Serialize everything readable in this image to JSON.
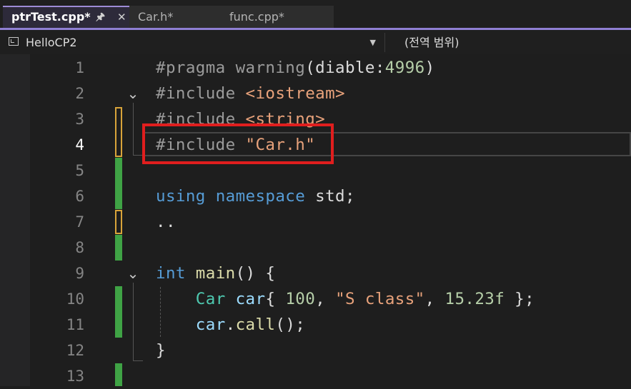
{
  "tabs": [
    {
      "label": "ptrTest.cpp*",
      "active": true,
      "pin_icon": "pin-icon",
      "close_icon": "close-icon"
    },
    {
      "label": "Car.h*",
      "active": false
    },
    {
      "label": "func.cpp*",
      "active": false
    }
  ],
  "navbar": {
    "project": "HelloCP2",
    "scope": "(전역 범위)"
  },
  "editor": {
    "current_line": 4,
    "line_numbers": [
      "1",
      "2",
      "3",
      "4",
      "5",
      "6",
      "7",
      "8",
      "9",
      "10",
      "11",
      "12",
      "13"
    ],
    "lines": [
      [
        {
          "t": "#pragma warning",
          "c": "pp"
        },
        {
          "t": "(",
          "c": "txt"
        },
        {
          "t": "diable",
          "c": "txt"
        },
        {
          "t": ":",
          "c": "txt"
        },
        {
          "t": "4996",
          "c": "num"
        },
        {
          "t": ")",
          "c": "txt"
        }
      ],
      [
        {
          "t": "#include ",
          "c": "pp"
        },
        {
          "t": "<iostream>",
          "c": "inc"
        }
      ],
      [
        {
          "t": "#include ",
          "c": "pp"
        },
        {
          "t": "<string>",
          "c": "inc"
        }
      ],
      [
        {
          "t": "#include ",
          "c": "pp"
        },
        {
          "t": "\"Car.h\"",
          "c": "str"
        }
      ],
      [],
      [
        {
          "t": "using",
          "c": "kw"
        },
        {
          "t": " ",
          "c": "txt"
        },
        {
          "t": "namespace",
          "c": "kw"
        },
        {
          "t": " std;",
          "c": "txt"
        }
      ],
      [
        {
          "t": "..",
          "c": "txt"
        }
      ],
      [],
      [
        {
          "t": "int",
          "c": "kw"
        },
        {
          "t": " ",
          "c": "txt"
        },
        {
          "t": "main",
          "c": "fn"
        },
        {
          "t": "() {",
          "c": "txt"
        }
      ],
      [
        {
          "t": "    ",
          "c": "txt"
        },
        {
          "t": "Car",
          "c": "type"
        },
        {
          "t": " ",
          "c": "txt"
        },
        {
          "t": "car",
          "c": "var"
        },
        {
          "t": "{ ",
          "c": "txt"
        },
        {
          "t": "100",
          "c": "num"
        },
        {
          "t": ", ",
          "c": "txt"
        },
        {
          "t": "\"S class\"",
          "c": "str"
        },
        {
          "t": ", ",
          "c": "txt"
        },
        {
          "t": "15.23f",
          "c": "num"
        },
        {
          "t": " };",
          "c": "txt"
        }
      ],
      [
        {
          "t": "    ",
          "c": "txt"
        },
        {
          "t": "car",
          "c": "var"
        },
        {
          "t": ".",
          "c": "txt"
        },
        {
          "t": "call",
          "c": "fn"
        },
        {
          "t": "();",
          "c": "txt"
        }
      ],
      [
        {
          "t": "}",
          "c": "txt"
        }
      ],
      []
    ],
    "fold_icons": [
      "chevron-down-icon",
      "chevron-down-icon"
    ]
  }
}
